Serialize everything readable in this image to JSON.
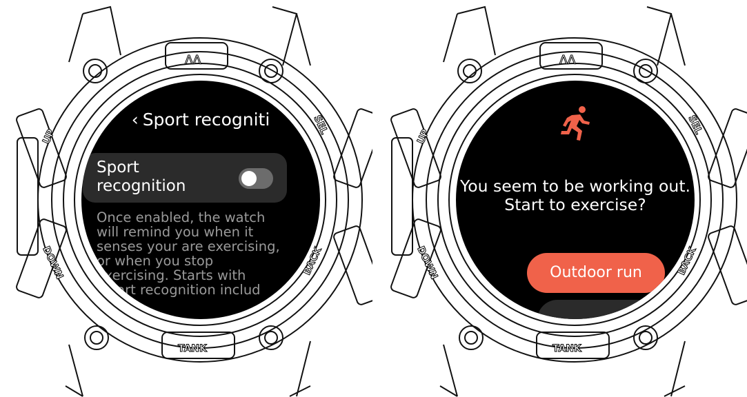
{
  "watch_left": {
    "bezel": {
      "top": "",
      "up": "UP",
      "down": "DOWN",
      "sel": "SEL",
      "back": "BACK",
      "bottom": "TANK"
    },
    "screen": {
      "title": "Sport recogniti",
      "toggle_label": "Sport recognition",
      "toggle_state": "off",
      "description": "Once enabled, the watch will remind you when it senses your are exercising, or when you stop exercising. Starts with smart recognition includ"
    }
  },
  "watch_right": {
    "bezel": {
      "up": "UP",
      "down": "DOWN",
      "sel": "SEL",
      "back": "BACK",
      "bottom": "TANK"
    },
    "screen": {
      "icon": "running-person-icon",
      "prompt": "You seem to be working out. Start to exercise?",
      "primary_button": "Outdoor run",
      "secondary_button": ""
    }
  },
  "colors": {
    "accent": "#f0624a",
    "card": "#2b2b2b",
    "desc_text": "#9a9a9a"
  }
}
